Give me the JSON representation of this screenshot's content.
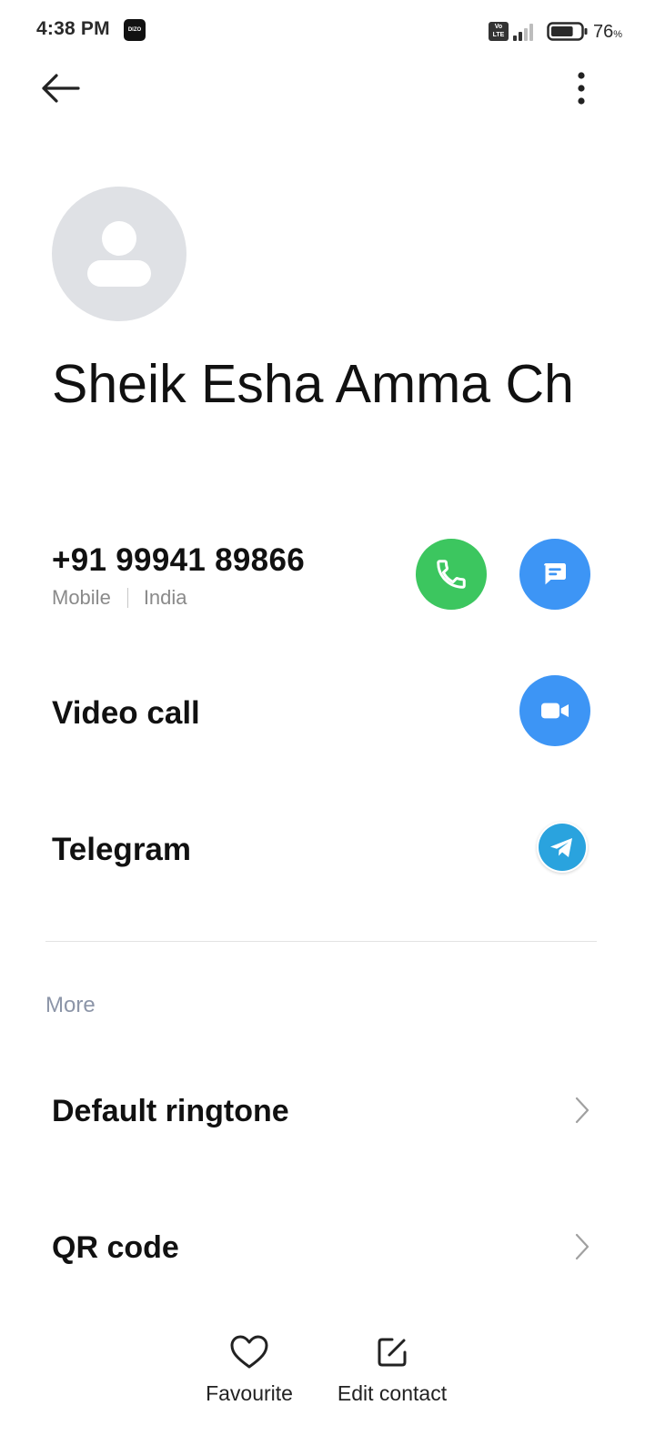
{
  "status_bar": {
    "time": "4:38 PM",
    "brand_badge": "DIZO",
    "network_badge_top": "Vo",
    "network_badge_bottom": "LTE",
    "battery_percent": "76",
    "battery_unit": "%",
    "battery_level": 0.76
  },
  "contact": {
    "name": "Sheik Esha Amma Ch",
    "phone": {
      "number": "+91 99941 89866",
      "type": "Mobile",
      "region": "India"
    }
  },
  "actions": {
    "video_call_label": "Video call",
    "telegram_label": "Telegram"
  },
  "more_section": {
    "title": "More",
    "items": [
      {
        "label": "Default ringtone"
      },
      {
        "label": "QR code"
      }
    ]
  },
  "bottom_bar": {
    "favourite_label": "Favourite",
    "edit_label": "Edit contact"
  },
  "colors": {
    "call_green": "#3cc65f",
    "action_blue": "#3d95f5",
    "telegram_blue": "#2aa3de",
    "avatar_gray": "#dfe1e5",
    "section_gray": "#8c95a8"
  },
  "icons": {
    "back": "arrow-left-icon",
    "more": "vertical-dots-icon",
    "call": "phone-icon",
    "message": "message-bubble-icon",
    "video": "video-camera-icon",
    "telegram": "telegram-plane-icon",
    "chevron": "chevron-right-icon",
    "favourite": "heart-outline-icon",
    "edit": "edit-square-icon"
  }
}
